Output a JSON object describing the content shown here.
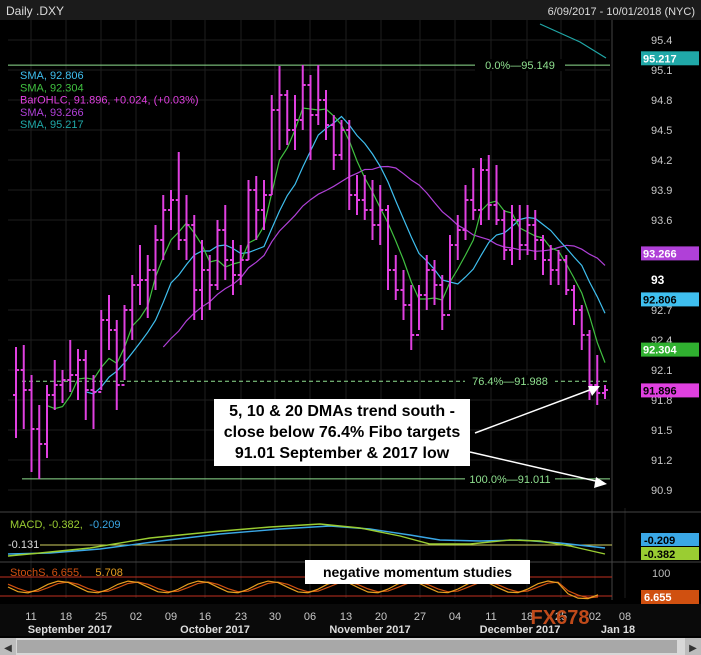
{
  "header": {
    "title": "Daily .DXY",
    "date_range": "6/09/2017 - 10/01/2018 (NYC)"
  },
  "colors": {
    "bg": "#000000",
    "grid": "#1e1e1e",
    "bar": "#e040e0",
    "sma5": "#40c040",
    "sma10": "#3fbfef",
    "sma20": "#b040d8",
    "sma_long": "#20a8a8",
    "fib": "#8fe08f",
    "macd_line": "#3aa7e6",
    "macd_signal": "#9acd32",
    "stoch_k": "#e8a020",
    "stoch_d": "#d05010",
    "stoch_bound": "#c03020",
    "axis_text": "#c8c8c8"
  },
  "legend": [
    {
      "text": "SMA, 92.806",
      "color": "#3fbfef"
    },
    {
      "text": "SMA, 92.304",
      "color": "#40c040"
    },
    {
      "text": "BarOHLC, 91.896, +0.024, (+0.03%)",
      "color": "#e040e0"
    },
    {
      "text": "SMA, 93.266",
      "color": "#b040d8"
    },
    {
      "text": "SMA, 95.217",
      "color": "#20a8a8"
    }
  ],
  "price_ticks": [
    "95.4",
    "95.1",
    "94.8",
    "94.5",
    "94.2",
    "93.9",
    "93.6",
    "93",
    "92.7",
    "92.4",
    "92.1",
    "91.8",
    "91.5",
    "91.2",
    "90.9"
  ],
  "price_ticks_bold": [
    "93"
  ],
  "price_badges": [
    {
      "text": "95.217",
      "value": 95.217,
      "bg": "#20a8a8",
      "fg": "#ffffff"
    },
    {
      "text": "93.266",
      "value": 93.266,
      "bg": "#b040d8",
      "fg": "#ffffff"
    },
    {
      "text": "92.806",
      "value": 92.806,
      "bg": "#3fbfef",
      "fg": "#000000"
    },
    {
      "text": "92.304",
      "value": 92.304,
      "bg": "#30b030",
      "fg": "#ffffff"
    },
    {
      "text": "91.896",
      "value": 91.896,
      "bg": "#e040e0",
      "fg": "#000000"
    }
  ],
  "fib_levels": [
    {
      "label": "0.0%—95.149",
      "value": 95.149,
      "dashed": false
    },
    {
      "label": "76.4%—91.988",
      "value": 91.988,
      "dashed": true
    },
    {
      "label": "100.0%—91.011",
      "value": 91.011,
      "dashed": false
    }
  ],
  "callouts": {
    "main": [
      "5, 10 & 20 DMAs trend south -",
      "close below 76.4% Fibo targets",
      "91.01 September & 2017 low"
    ],
    "momentum": "negative momentum studies"
  },
  "macd_panel": {
    "label": "MACD, -0.382, -0.209",
    "label_parts": [
      {
        "text": "MACD, -0.382,",
        "color": "#9acd32"
      },
      {
        "text": " -0.209",
        "color": "#3aa7e6"
      }
    ],
    "zero_label": "-0.131",
    "badges": [
      {
        "text": "-0.209",
        "bg": "#3aa7e6",
        "fg": "#000000"
      },
      {
        "text": "-0.382",
        "bg": "#9acd32",
        "fg": "#000000"
      }
    ]
  },
  "stoch_panel": {
    "label_parts": [
      {
        "text": "StochS, 6.655,",
        "color": "#d05010"
      },
      {
        "text": " 5.708",
        "color": "#e8a020"
      }
    ],
    "scale_label": "100",
    "badge": {
      "text": "6.655",
      "bg": "#d05010",
      "fg": "#ffffff"
    }
  },
  "x_day_labels": [
    "11",
    "18",
    "25",
    "02",
    "09",
    "16",
    "23",
    "30",
    "06",
    "13",
    "20",
    "27",
    "04",
    "11",
    "18",
    "25",
    "02",
    "08"
  ],
  "x_month_labels": [
    "September 2017",
    "October 2017",
    "November 2017",
    "December 2017",
    "Jan 18"
  ],
  "watermark": "FX678",
  "chart_data": {
    "type": "ohlc",
    "title": "Daily .DXY",
    "date_range": "6/09/2017 - 10/01/2018 (NYC)",
    "ylim": [
      90.75,
      95.6
    ],
    "bars": [
      [
        91.85,
        92.33,
        91.42,
        92.1
      ],
      [
        92.1,
        92.35,
        91.51,
        91.9
      ],
      [
        91.9,
        92.05,
        91.08,
        91.51
      ],
      [
        91.51,
        91.75,
        91.01,
        91.36
      ],
      [
        91.36,
        91.95,
        91.22,
        91.85
      ],
      [
        91.85,
        92.2,
        91.7,
        91.95
      ],
      [
        91.95,
        92.1,
        91.77,
        92.0
      ],
      [
        92.0,
        92.4,
        91.88,
        92.05
      ],
      [
        92.05,
        92.31,
        91.8,
        92.2
      ],
      [
        92.2,
        92.3,
        91.6,
        91.9
      ],
      [
        91.9,
        92.05,
        91.51,
        91.88
      ],
      [
        91.88,
        92.7,
        91.9,
        92.6
      ],
      [
        92.6,
        92.85,
        92.3,
        92.5
      ],
      [
        92.5,
        92.6,
        91.7,
        91.95
      ],
      [
        91.95,
        92.75,
        92.0,
        92.7
      ],
      [
        92.7,
        93.05,
        92.4,
        92.95
      ],
      [
        92.95,
        93.35,
        92.75,
        93.0
      ],
      [
        93.0,
        93.25,
        92.62,
        93.1
      ],
      [
        93.1,
        93.55,
        92.9,
        93.4
      ],
      [
        93.4,
        93.85,
        93.2,
        93.7
      ],
      [
        93.7,
        93.9,
        93.5,
        93.8
      ],
      [
        93.8,
        94.28,
        93.3,
        93.4
      ],
      [
        93.4,
        93.85,
        93.2,
        93.55
      ],
      [
        93.55,
        93.65,
        92.6,
        92.9
      ],
      [
        92.9,
        93.4,
        92.6,
        93.1
      ],
      [
        93.1,
        93.25,
        92.7,
        92.95
      ],
      [
        92.95,
        93.6,
        92.9,
        93.5
      ],
      [
        93.5,
        93.75,
        93.0,
        93.2
      ],
      [
        93.2,
        93.4,
        92.85,
        93.05
      ],
      [
        93.05,
        93.35,
        92.95,
        93.2
      ],
      [
        93.2,
        94.0,
        93.2,
        93.9
      ],
      [
        93.9,
        94.04,
        93.4,
        93.7
      ],
      [
        93.7,
        94.0,
        93.5,
        93.85
      ],
      [
        93.85,
        94.85,
        93.85,
        94.7
      ],
      [
        94.7,
        95.14,
        94.3,
        94.85
      ],
      [
        94.85,
        94.9,
        94.35,
        94.5
      ],
      [
        94.5,
        94.85,
        94.3,
        94.6
      ],
      [
        94.6,
        95.15,
        94.5,
        94.95
      ],
      [
        94.95,
        95.05,
        94.2,
        94.65
      ],
      [
        94.65,
        95.15,
        94.55,
        94.8
      ],
      [
        94.8,
        94.9,
        94.4,
        94.55
      ],
      [
        94.55,
        94.65,
        94.1,
        94.25
      ],
      [
        94.25,
        94.6,
        94.2,
        94.5
      ],
      [
        94.5,
        94.6,
        93.7,
        93.85
      ],
      [
        93.85,
        94.05,
        93.65,
        93.8
      ],
      [
        93.8,
        94.05,
        93.6,
        93.7
      ],
      [
        93.7,
        94.0,
        93.4,
        93.55
      ],
      [
        93.55,
        93.95,
        93.35,
        93.7
      ],
      [
        93.7,
        93.75,
        92.9,
        93.1
      ],
      [
        93.1,
        93.25,
        92.8,
        92.9
      ],
      [
        92.9,
        93.1,
        92.6,
        92.75
      ],
      [
        92.75,
        92.95,
        92.3,
        92.45
      ],
      [
        92.45,
        92.95,
        92.5,
        92.85
      ],
      [
        92.85,
        93.25,
        92.7,
        93.1
      ],
      [
        93.1,
        93.2,
        92.75,
        92.95
      ],
      [
        92.95,
        93.05,
        92.5,
        92.65
      ],
      [
        92.65,
        93.45,
        92.7,
        93.35
      ],
      [
        93.35,
        93.65,
        93.2,
        93.5
      ],
      [
        93.5,
        93.95,
        93.4,
        93.8
      ],
      [
        93.8,
        94.12,
        93.6,
        93.7
      ],
      [
        93.7,
        94.22,
        93.55,
        94.1
      ],
      [
        94.1,
        94.25,
        93.6,
        93.75
      ],
      [
        93.75,
        94.15,
        93.55,
        93.6
      ],
      [
        93.6,
        93.7,
        93.2,
        93.3
      ],
      [
        93.3,
        93.75,
        93.15,
        93.6
      ],
      [
        93.6,
        93.75,
        93.2,
        93.35
      ],
      [
        93.35,
        93.75,
        93.25,
        93.55
      ],
      [
        93.55,
        93.7,
        93.2,
        93.4
      ],
      [
        93.4,
        93.45,
        93.05,
        93.2
      ],
      [
        93.2,
        93.35,
        92.95,
        93.1
      ],
      [
        93.1,
        93.3,
        92.95,
        93.2
      ],
      [
        93.2,
        93.25,
        92.85,
        92.9
      ],
      [
        92.9,
        92.95,
        92.55,
        92.7
      ],
      [
        92.7,
        92.75,
        92.3,
        92.45
      ],
      [
        92.45,
        92.5,
        91.8,
        91.95
      ],
      [
        91.95,
        92.25,
        91.75,
        91.87
      ],
      [
        91.87,
        91.95,
        91.81,
        91.9
      ]
    ],
    "series": [
      {
        "name": "SMA, 92.806",
        "period": 10
      },
      {
        "name": "SMA, 92.304",
        "period": 5
      },
      {
        "name": "SMA, 93.266",
        "period": 20
      },
      {
        "name": "SMA, 95.217",
        "last_value": 95.217
      }
    ],
    "fibonacci": [
      {
        "level": "0.0%",
        "value": 95.149
      },
      {
        "level": "76.4%",
        "value": 91.988
      },
      {
        "level": "100.0%",
        "value": 91.011
      }
    ],
    "macd": {
      "macd": -0.382,
      "signal": -0.209,
      "zero_ref": -0.131
    },
    "stochastic": {
      "k": 6.655,
      "d": 5.708,
      "upper": 80,
      "lower": 20
    }
  }
}
